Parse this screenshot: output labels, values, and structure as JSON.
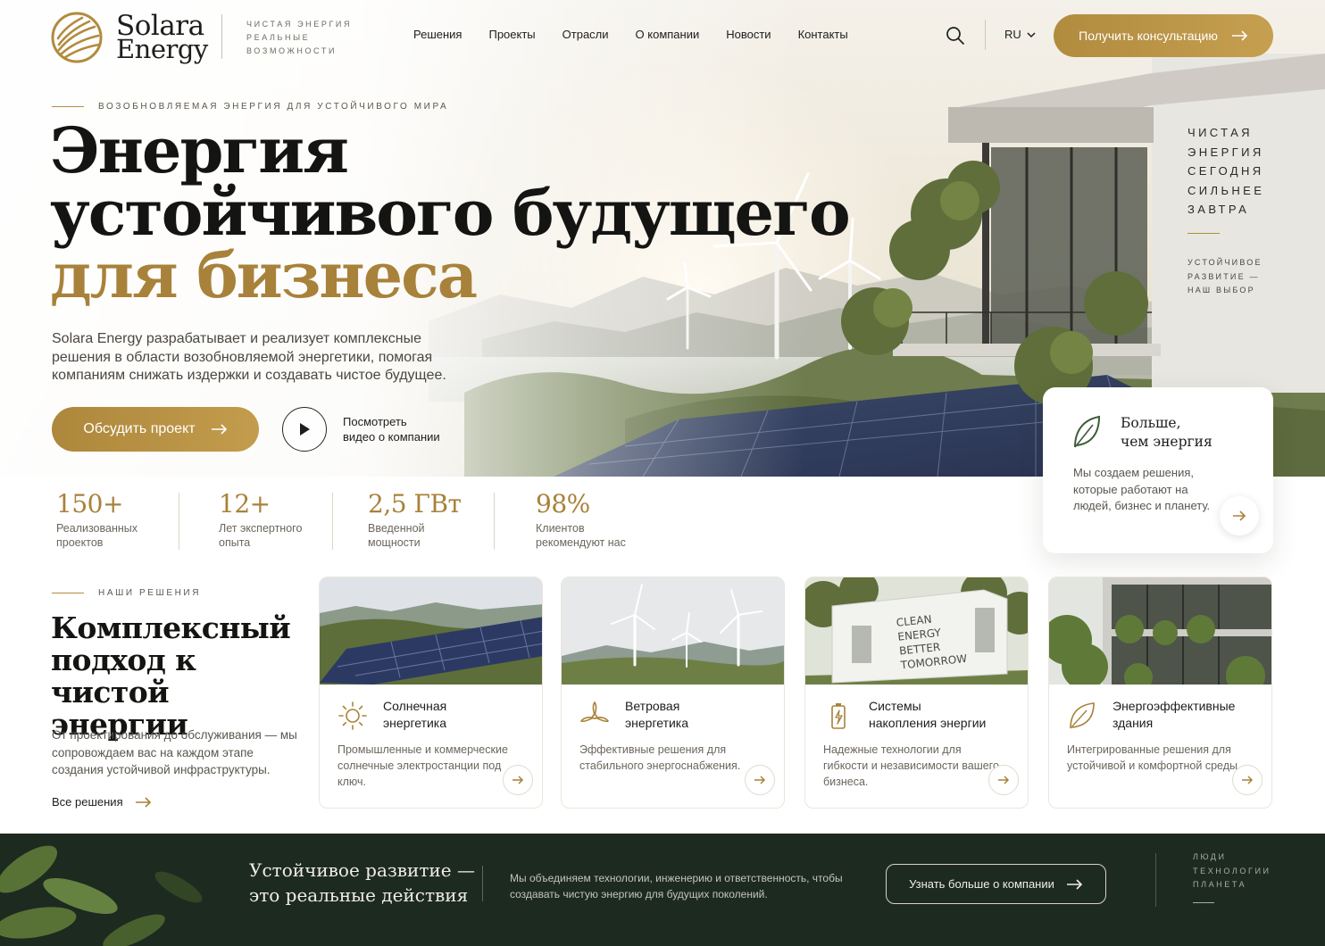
{
  "brand": {
    "name_line1": "Solara",
    "name_line2": "Energy",
    "tagline": [
      "ЧИСТАЯ ЭНЕРГИЯ",
      "РЕАЛЬНЫЕ",
      "ВОЗМОЖНОСТИ"
    ],
    "accent_color": "#b18b3e",
    "dark_color": "#1d2a20"
  },
  "nav": {
    "items": [
      "Решения",
      "Проекты",
      "Отрасли",
      "О компании",
      "Новости",
      "Контакты"
    ],
    "language": "RU",
    "cta_label": "Получить консультацию"
  },
  "hero": {
    "eyebrow": "ВОЗОБНОВЛЯЕМАЯ ЭНЕРГИЯ ДЛЯ УСТОЙЧИВОГО МИРА",
    "title_line1": "Энергия",
    "title_line2": "устойчивого будущего",
    "title_line3": "для бизнеса",
    "description": "Solara Energy разрабатывает и реализует комплексные решения в области возобновляемой энергетики, помогая компаниям снижать издержки и создавать чистое будущее.",
    "primary_button": "Обсудить проект",
    "video_label_line1": "Посмотреть",
    "video_label_line2": "видео о компании",
    "side_words": [
      "ЧИСТАЯ",
      "ЭНЕРГИЯ",
      "СЕГОДНЯ",
      "СИЛЬНЕЕ",
      "ЗАВТРА"
    ],
    "side_sub": [
      "УСТОЙЧИВОЕ",
      "РАЗВИТИЕ —",
      "НАШ ВЫБОР"
    ]
  },
  "highlight_card": {
    "title_line1": "Больше,",
    "title_line2": "чем энергия",
    "text": "Мы создаем решения, которые работают на людей, бизнес и планету.",
    "icon": "leaf-icon"
  },
  "stats": [
    {
      "value": "150+",
      "label_line1": "Реализованных",
      "label_line2": "проектов"
    },
    {
      "value": "12+",
      "label_line1": "Лет экспертного",
      "label_line2": "опыта"
    },
    {
      "value": "2,5 ГВт",
      "label_line1": "Введенной",
      "label_line2": "мощности"
    },
    {
      "value": "98%",
      "label_line1": "Клиентов",
      "label_line2": "рекомендуют нас"
    }
  ],
  "solutions": {
    "eyebrow": "НАШИ РЕШЕНИЯ",
    "title": "Комплексный подход к чистой энергии",
    "description": "От проектирования до обслуживания — мы сопровождаем вас на каждом этапе создания устойчивой инфраструктуры.",
    "all_link": "Все решения",
    "cards": [
      {
        "title_line1": "Солнечная",
        "title_line2": "энергетика",
        "text": "Промышленные и коммерческие солнечные электростанции под ключ.",
        "icon": "sun-icon"
      },
      {
        "title_line1": "Ветровая",
        "title_line2": "энергетика",
        "text": "Эффективные решения для стабильного энергоснабжения.",
        "icon": "wind-turbine-icon"
      },
      {
        "title_line1": "Системы",
        "title_line2": "накопления энергии",
        "text": "Надежные технологии для гибкости и независимости вашего бизнеса.",
        "icon": "battery-icon",
        "image_text": [
          "CLEAN",
          "ENERGY",
          "BETTER",
          "TOMORROW"
        ]
      },
      {
        "title_line1": "Энергоэффективные",
        "title_line2": "здания",
        "text": "Интегрированные решения для устойчивой и комфортной среды.",
        "icon": "leaf-icon"
      }
    ]
  },
  "band": {
    "title_line1": "Устойчивое развитие —",
    "title_line2": "это реальные действия",
    "text": "Мы объединяем технологии, инженерию и ответственность, чтобы создавать чистую энергию для будущих поколений.",
    "button": "Узнать больше о компании",
    "words": [
      "ЛЮДИ",
      "ТЕХНОЛОГИИ",
      "ПЛАНЕТА"
    ]
  }
}
